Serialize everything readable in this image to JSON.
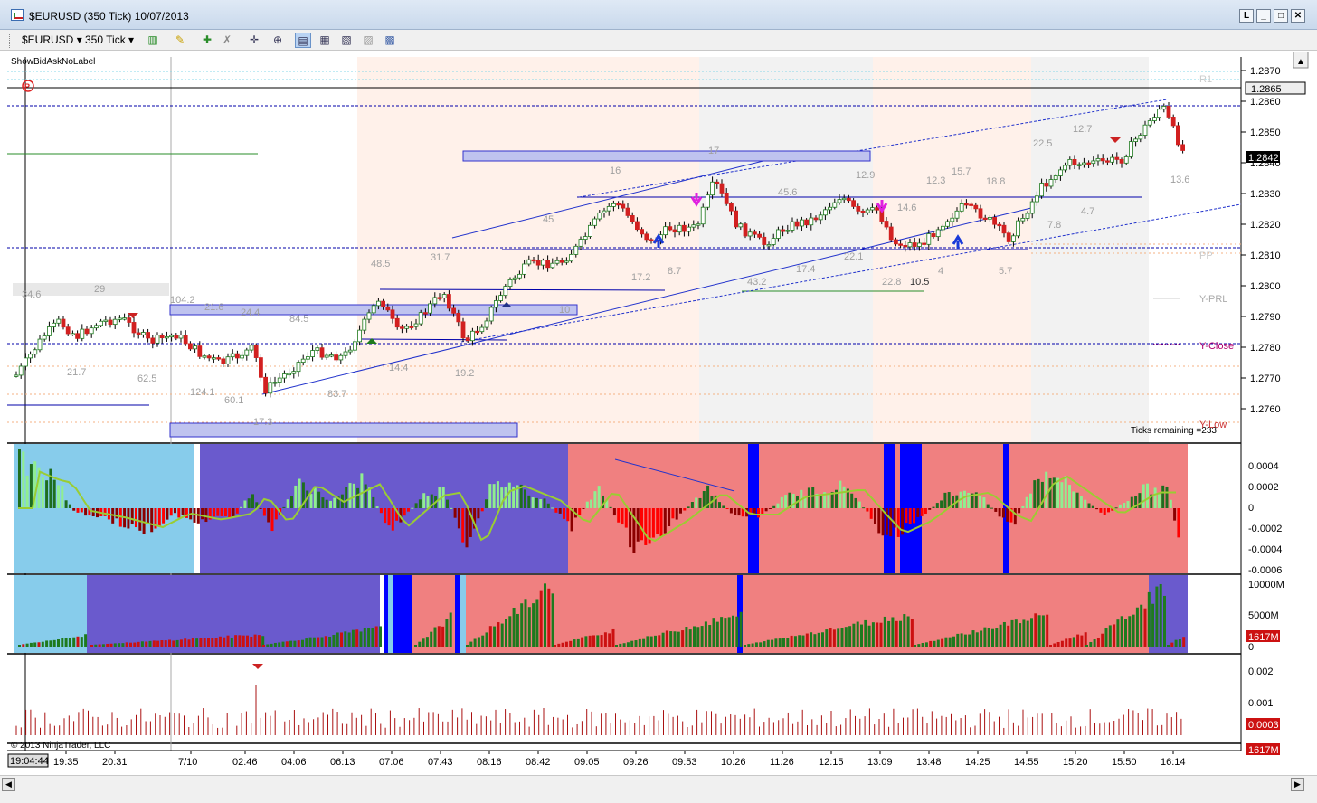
{
  "window": {
    "title": "$EURUSD (350 Tick)  10/07/2013",
    "buttons": [
      "L",
      "□",
      "✕"
    ]
  },
  "toolbar": {
    "instrument": "$EURUSD",
    "interval": "350 Tick",
    "icons": [
      "bar-style-icon",
      "draw-pencil-icon",
      "insert-icon",
      "remove-icon",
      "crosshair-icon",
      "zoom-icon",
      "data-box-icon",
      "strategies-icon",
      "indicators-icon",
      "properties-icon",
      "chart-trader-icon"
    ]
  },
  "indicator_label": "ShowBidAskNoLabel",
  "ticks_remaining": "Ticks remaining =233",
  "copyright": "© 2013 NinjaTrader, LLC",
  "price_axis": {
    "ticks": [
      "1.2870",
      "1.2860",
      "1.2850",
      "1.2840",
      "1.2830",
      "1.2820",
      "1.2810",
      "1.2800",
      "1.2790",
      "1.2780",
      "1.2770",
      "1.2760"
    ],
    "current_tag": "1.2842",
    "line_tag": "1.2865"
  },
  "pivot_labels": [
    "R1",
    "PP",
    "Y-PRL",
    "Y-Close",
    "Y-Low"
  ],
  "osc_axis": [
    "0.0004",
    "0.0002",
    "0",
    "-0.0002",
    "-0.0004",
    "-0.0006"
  ],
  "vol_axis": [
    "10000M",
    "5000M",
    "0"
  ],
  "vol_tag": "1617M",
  "vol3_axis": [
    "0.002",
    "0.001"
  ],
  "vol3_tag": "0.0003",
  "bottom_tag": "1617M",
  "time_axis": {
    "current": "19:04:44",
    "labels": [
      "19:35",
      "20:31",
      "7/10",
      "02:46",
      "04:06",
      "06:13",
      "07:06",
      "07:43",
      "08:16",
      "08:42",
      "09:05",
      "09:26",
      "09:53",
      "10:26",
      "11:26",
      "12:15",
      "13:09",
      "13:48",
      "14:25",
      "14:55",
      "15:20",
      "15:50",
      "16:14"
    ]
  },
  "swing_labels": [
    "34.6",
    "29",
    "104.2",
    "21.6",
    "24.4",
    "84.5",
    "48.5",
    "31.7",
    "45",
    "16",
    "17",
    "12.9",
    "45.6",
    "12.3",
    "15.7",
    "18.8",
    "22.5",
    "12.7",
    "13.6",
    "21.7",
    "62.5",
    "124.1",
    "60.1",
    "17.3",
    "83.7",
    "14.4",
    "19.2",
    "10",
    "17.2",
    "8.7",
    "43.2",
    "17.4",
    "22.1",
    "22.8",
    "10.5",
    "4",
    "5.7",
    "7.8",
    "4.7",
    "14.6"
  ],
  "colors": {
    "bull_candle": "#1e7a1e",
    "bear_candle": "#d22020",
    "zone_fill": "#bfc3ef",
    "osc_cyan": "#87cceb",
    "osc_purple": "#6a5acd",
    "osc_salmon": "#f08080",
    "osc_blue": "#0000ff"
  }
}
